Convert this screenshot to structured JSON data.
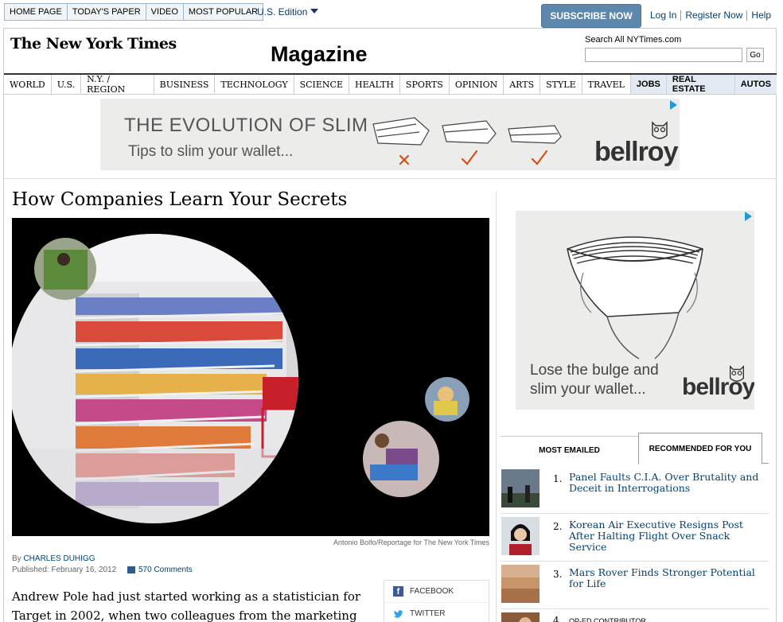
{
  "topnav": {
    "links": [
      "HOME PAGE",
      "TODAY'S PAPER",
      "VIDEO",
      "MOST POPULAR"
    ],
    "edition": "U.S. Edition",
    "subscribe": "SUBSCRIBE NOW",
    "user_links": [
      "Log In",
      "Register Now",
      "Help"
    ]
  },
  "masthead": {
    "logo": "The New York Times",
    "section": "Magazine",
    "search_label": "Search All NYTimes.com",
    "search_value": "",
    "go": "Go"
  },
  "sections": [
    "WORLD",
    "U.S.",
    "N.Y. / REGION",
    "BUSINESS",
    "TECHNOLOGY",
    "SCIENCE",
    "HEALTH",
    "SPORTS",
    "OPINION",
    "ARTS",
    "STYLE",
    "TRAVEL"
  ],
  "classifieds": [
    "JOBS",
    "REAL ESTATE",
    "AUTOS"
  ],
  "ad_top": {
    "headline": "THE EVOLUTION OF SLIM",
    "subline": "Tips to slim your wallet...",
    "brand": "bellroy"
  },
  "article": {
    "headline": "How Companies Learn Your Secrets",
    "photo_credit": "Antonio Bolfo/Reportage for The New York Times",
    "byline_prefix": "By",
    "author": "CHARLES DUHIGG",
    "published": "Published: February 16, 2012",
    "comments": "570 Comments",
    "body": "Andrew Pole had just started working as a statistician for Target in 2002, when two colleagues from the marketing department stopped"
  },
  "share": {
    "facebook": "FACEBOOK",
    "twitter": "TWITTER"
  },
  "ad_right": {
    "line1": "Lose the bulge and",
    "line2": "slim your wallet...",
    "brand": "bellroy"
  },
  "tabs": {
    "most_emailed": "MOST EMAILED",
    "recommended": "RECOMMENDED FOR YOU"
  },
  "recommended": [
    {
      "num": "1.",
      "title": "Panel Faults C.I.A. Over Brutality and Deceit in Interrogations"
    },
    {
      "num": "2.",
      "title": "Korean Air Executive Resigns Post After Halting Flight Over Snack Service"
    },
    {
      "num": "3.",
      "title": "Mars Rover Finds Stronger Potential for Life"
    },
    {
      "num": "4.",
      "title": "OP-ED CONTRIBUTOR"
    }
  ]
}
